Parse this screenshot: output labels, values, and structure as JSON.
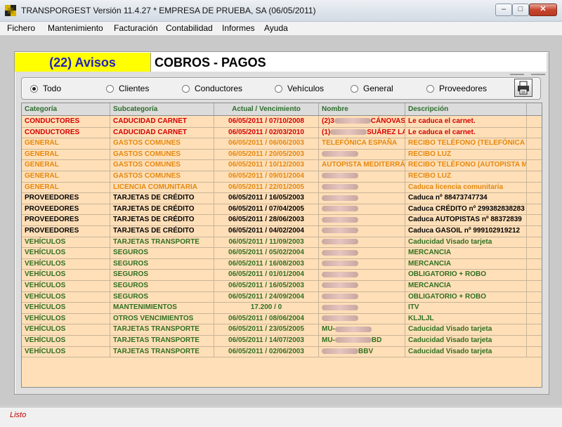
{
  "window": {
    "title": "TRANSPORGEST Versión 11.4.27 * EMPRESA DE PRUEBA, SA (06/05/2011)",
    "controls": {
      "minimize": "–",
      "maximize": "□",
      "close": "✕"
    }
  },
  "menu": [
    "Fichero",
    "Mantenimiento",
    "Facturación",
    "Contabilidad",
    "Informes",
    "Ayuda"
  ],
  "avisos_label": "(22) Avisos",
  "section_title": "COBROS - PAGOS",
  "filters": [
    {
      "label": "Todo",
      "selected": true
    },
    {
      "label": "Clientes",
      "selected": false
    },
    {
      "label": "Conductores",
      "selected": false
    },
    {
      "label": "Vehículos",
      "selected": false
    },
    {
      "label": "General",
      "selected": false
    },
    {
      "label": "Proveedores",
      "selected": false
    }
  ],
  "print_icon": "printer-icon",
  "table": {
    "headers": [
      "Categoría",
      "Subcategoría",
      "Actual / Vencimiento",
      "Nombre",
      "Descripción"
    ],
    "rows": [
      {
        "color": "red",
        "cat": "CONDUCTORES",
        "sub": "CADUCIDAD CARNET",
        "date": "06/05/2011 / 07/10/2008",
        "name_pre": "(2)3",
        "name_post": "CÁNOVAS",
        "desc": "Le caduca el carnet."
      },
      {
        "color": "red",
        "cat": "CONDUCTORES",
        "sub": "CADUCIDAD CARNET",
        "date": "06/05/2011 / 02/03/2010",
        "name_pre": "(1)",
        "name_post": "SUÁREZ LA",
        "desc": "Le caduca el carnet."
      },
      {
        "color": "orange",
        "cat": "GENERAL",
        "sub": "GASTOS COMUNES",
        "date": "06/05/2011 / 06/06/2003",
        "name_pre": "TELEFÓNICA ESPAÑA",
        "name_post": "",
        "desc": "RECIBO TELÉFONO (TELEFÓNICA"
      },
      {
        "color": "orange",
        "cat": "GENERAL",
        "sub": "GASTOS COMUNES",
        "date": "06/05/2011 / 20/05/2003",
        "name_pre": "",
        "name_post": "",
        "desc": "RECIBO LUZ"
      },
      {
        "color": "orange",
        "cat": "GENERAL",
        "sub": "GASTOS COMUNES",
        "date": "06/05/2011 / 10/12/2003",
        "name_pre": "AUTOPISTA MEDITERRÁ",
        "name_post": "",
        "desc": "RECIBO TELÉFONO (AUTOPISTA M"
      },
      {
        "color": "orange",
        "cat": "GENERAL",
        "sub": "GASTOS COMUNES",
        "date": "06/05/2011 / 09/01/2004",
        "name_pre": "",
        "name_post": "",
        "desc": "RECIBO LUZ"
      },
      {
        "color": "orange",
        "cat": "GENERAL",
        "sub": "LICENCIA COMUNITARIA",
        "date": "06/05/2011 / 22/01/2005",
        "name_pre": "",
        "name_post": "",
        "desc": "Caduca licencia comunitaria"
      },
      {
        "color": "black",
        "cat": "PROVEEDORES",
        "sub": "TARJETAS DE CRÉDITO",
        "date": "06/05/2011 / 16/05/2003",
        "name_pre": "",
        "name_post": "",
        "desc": "Caduca  nº 88473747734"
      },
      {
        "color": "black",
        "cat": "PROVEEDORES",
        "sub": "TARJETAS DE CRÉDITO",
        "date": "06/05/2011 / 07/04/2005",
        "name_pre": "",
        "name_post": "",
        "desc": "Caduca CRÉDITO nº 299382838283"
      },
      {
        "color": "black",
        "cat": "PROVEEDORES",
        "sub": "TARJETAS DE CRÉDITO",
        "date": "06/05/2011 / 28/06/2003",
        "name_pre": "",
        "name_post": "",
        "desc": "Caduca AUTOPISTAS nº 88372839"
      },
      {
        "color": "black",
        "cat": "PROVEEDORES",
        "sub": "TARJETAS DE CRÉDITO",
        "date": "06/05/2011 / 04/02/2004",
        "name_pre": "",
        "name_post": "",
        "desc": "Caduca GASOIL nº 999102919212"
      },
      {
        "color": "green",
        "cat": "VEHÍCULOS",
        "sub": "TARJETAS TRANSPORTE",
        "date": "06/05/2011 / 11/09/2003",
        "name_pre": "",
        "name_post": "",
        "desc": "Caducidad Visado tarjeta"
      },
      {
        "color": "green",
        "cat": "VEHÍCULOS",
        "sub": "SEGUROS",
        "date": "06/05/2011 / 05/02/2004",
        "name_pre": "",
        "name_post": "",
        "desc": "MERCANCIA"
      },
      {
        "color": "green",
        "cat": "VEHÍCULOS",
        "sub": "SEGUROS",
        "date": "06/05/2011 / 16/08/2003",
        "name_pre": "",
        "name_post": "",
        "desc": "MERCANCIA"
      },
      {
        "color": "green",
        "cat": "VEHÍCULOS",
        "sub": "SEGUROS",
        "date": "06/05/2011 / 01/01/2004",
        "name_pre": "",
        "name_post": "",
        "desc": "OBLIGATORIO + ROBO"
      },
      {
        "color": "green",
        "cat": "VEHÍCULOS",
        "sub": "SEGUROS",
        "date": "06/05/2011 / 16/05/2003",
        "name_pre": "",
        "name_post": "",
        "desc": "MERCANCIA"
      },
      {
        "color": "green",
        "cat": "VEHÍCULOS",
        "sub": "SEGUROS",
        "date": "06/05/2011 / 24/09/2004",
        "name_pre": "",
        "name_post": "",
        "desc": "OBLIGATORIO + ROBO"
      },
      {
        "color": "green",
        "cat": "VEHÍCULOS",
        "sub": "MANTENIMIENTOS",
        "date": "17.200 / 0",
        "name_pre": "",
        "name_post": "",
        "desc": "ITV"
      },
      {
        "color": "green",
        "cat": "VEHÍCULOS",
        "sub": "OTROS VENCIMIENTOS",
        "date": "06/05/2011 / 08/06/2004",
        "name_pre": "",
        "name_post": "",
        "desc": "KLJLJL"
      },
      {
        "color": "green",
        "cat": "VEHÍCULOS",
        "sub": "TARJETAS TRANSPORTE",
        "date": "06/05/2011 / 23/05/2005",
        "name_pre": "MU-",
        "name_post": "",
        "desc": "Caducidad Visado tarjeta"
      },
      {
        "color": "green",
        "cat": "VEHÍCULOS",
        "sub": "TARJETAS TRANSPORTE",
        "date": "06/05/2011 / 14/07/2003",
        "name_pre": "MU-",
        "name_post": "BD",
        "desc": "Caducidad Visado tarjeta"
      },
      {
        "color": "green",
        "cat": "VEHÍCULOS",
        "sub": "TARJETAS TRANSPORTE",
        "date": "06/05/2011 / 02/06/2003",
        "name_pre": "",
        "name_post": "BBV",
        "desc": "Caducidad Visado tarjeta"
      }
    ]
  },
  "status": "Listo"
}
